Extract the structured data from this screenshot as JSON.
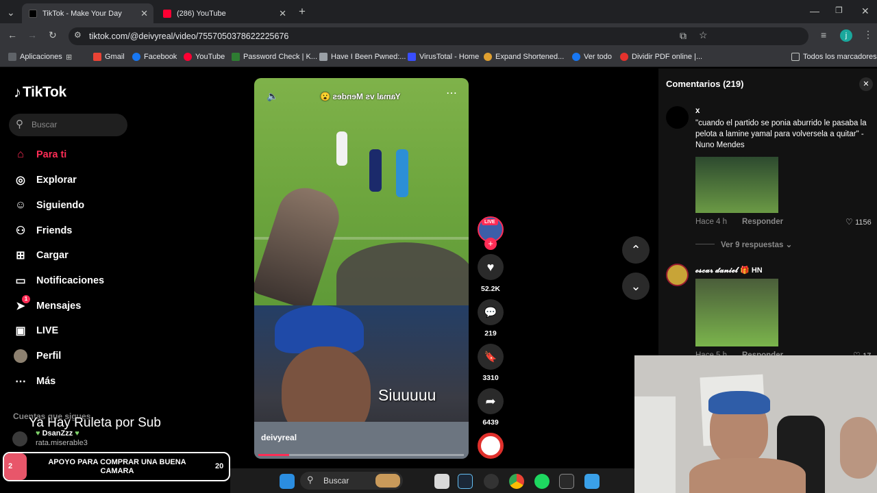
{
  "browser": {
    "tabs": [
      {
        "title": "TikTok - Make Your Day",
        "active": true
      },
      {
        "title": "(286) YouTube",
        "active": false
      }
    ],
    "new_tab": "+",
    "url": "tiktok.com/@deivyreal/video/7557050378622225676",
    "profile_initial": "j",
    "bookmarks": [
      "Aplicaciones",
      "Gmail",
      "Facebook",
      "YouTube",
      "Password Check | K...",
      "Have I Been Pwned:...",
      "VirusTotal - Home",
      "Expand Shortened...",
      "Ver todo",
      "Dividir PDF online |...",
      "Todos los marcadores"
    ]
  },
  "tiktok": {
    "logo": "TikTok",
    "search_placeholder": "Buscar",
    "nav": [
      {
        "label": "Para ti",
        "icon": "home-icon",
        "active": true
      },
      {
        "label": "Explorar",
        "icon": "compass-icon"
      },
      {
        "label": "Siguiendo",
        "icon": "following-icon"
      },
      {
        "label": "Friends",
        "icon": "friends-icon"
      },
      {
        "label": "Cargar",
        "icon": "upload-icon"
      },
      {
        "label": "Notificaciones",
        "icon": "notification-icon"
      },
      {
        "label": "Mensajes",
        "icon": "message-icon",
        "badge": "1"
      },
      {
        "label": "LIVE",
        "icon": "live-icon"
      },
      {
        "label": "Perfil",
        "icon": "avatar-icon"
      },
      {
        "label": "Más",
        "icon": "more-icon"
      }
    ],
    "following_title": "Cuentas que sigues",
    "following_user_name": "DsanZzz",
    "following_user_handle": "rata.miserable3",
    "video": {
      "overlay_title": "Yamal vs Mendes 😮",
      "caption_text": "Siuuuuu",
      "author": "deivyreal",
      "progress": 0.15
    },
    "actions": {
      "live_badge": "LIVE",
      "likes": "52.2K",
      "comments": "219",
      "saves": "3310",
      "shares": "6439"
    },
    "comments": {
      "title": "Comentarios (219)",
      "items": [
        {
          "user": "x",
          "text": "\"cuando el partido se ponia aburrido le pasaba la pelota a lamine yamal para volversela a quitar\" -Nuno Mendes",
          "time": "Hace 4 h",
          "reply": "Responder",
          "likes": "1156",
          "view_replies": "Ver 9 respuestas"
        },
        {
          "user": "𝓸𝓼𝓬𝓪𝓻 𝓭𝓪𝓷𝓲𝓮𝓵 🎁 HN",
          "time": "Hace 5 h",
          "reply": "Responder",
          "likes": "17"
        }
      ]
    }
  },
  "stream_overlay": {
    "ruleta": "Ya Hay Ruleta por Sub",
    "goal_text": "APOYO PARA COMPRAR UNA BUENA CAMARA",
    "goal_current": "2",
    "goal_target": "20",
    "goal_progress": 0.1
  },
  "taskbar": {
    "search": "Buscar"
  },
  "colors": {
    "accent": "#fe2c55",
    "chrome_dark": "#202124",
    "chrome_mid": "#35363a",
    "goal_bar": "#e8566a"
  }
}
